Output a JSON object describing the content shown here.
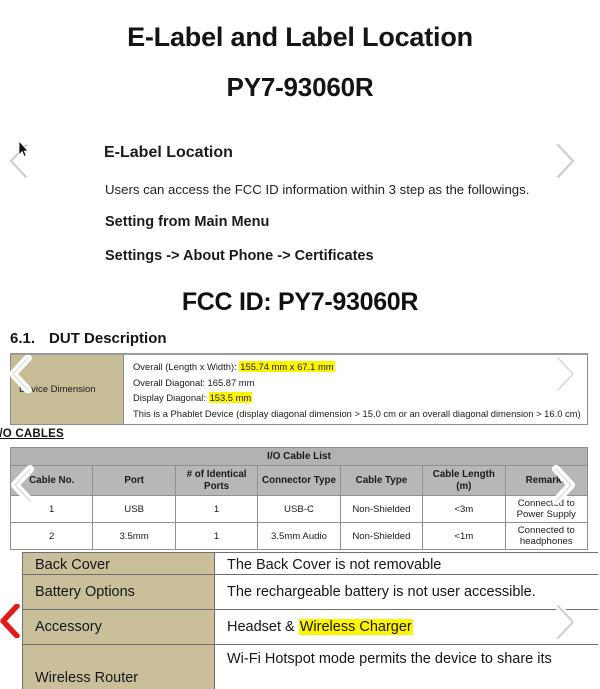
{
  "document": {
    "title": "E-Label and Label Location",
    "subtitle": "PY7-93060R"
  },
  "elabel": {
    "heading": "E-Label Location",
    "description": "Users can access the FCC ID information within 3 step as the followings.",
    "setting_heading": "Setting from Main Menu",
    "nav_path": "Settings -> About Phone -> Certificates",
    "fcc_id_display": "FCC ID: PY7-93060R"
  },
  "dut": {
    "section_number": "6.1.",
    "section_title": "DUT Description",
    "row_label": "Device Dimension",
    "lines": [
      {
        "prefix": "Overall (Length x Width): ",
        "highlight": "155.74 mm x 67.1 mm",
        "suffix": ""
      },
      {
        "prefix": "Overall Diagonal: 165.87 mm",
        "highlight": "",
        "suffix": ""
      },
      {
        "prefix": "Display Diagonal: ",
        "highlight": "153.5 mm",
        "suffix": ""
      },
      {
        "prefix": "This is a Phablet Device (display diagonal dimension > 15.0 cm or an overall diagonal dimension > 16.0 cm)",
        "highlight": "",
        "suffix": ""
      }
    ]
  },
  "io_cables": {
    "section_label": "I/O CABLES",
    "table_title": "I/O Cable List",
    "columns": [
      "Cable No.",
      "Port",
      "# of Identical Ports",
      "Connector Type",
      "Cable Type",
      "Cable Length (m)",
      "Remarks"
    ],
    "rows": [
      [
        "1",
        "USB",
        "1",
        "USB-C",
        "Non-Shielded",
        "<3m",
        "Connected to Power Supply"
      ],
      [
        "2",
        "3.5mm",
        "1",
        "3.5mm Audio",
        "Non-Shielded",
        "<1m",
        "Connected to headphones"
      ]
    ]
  },
  "spec_table": {
    "rows": [
      {
        "key": "Back Cover",
        "value_prefix": "The Back Cover is not removable",
        "value_highlight": "",
        "value_suffix": ""
      },
      {
        "key": "Battery Options",
        "value_prefix": "The rechargeable battery is not user accessible.",
        "value_highlight": "",
        "value_suffix": ""
      },
      {
        "key": "Accessory",
        "value_prefix": "Headset & ",
        "value_highlight": "Wireless Charger",
        "value_suffix": ""
      },
      {
        "key": "Wireless Router",
        "value_prefix": "Wi-Fi Hotspot mode permits the device to share its",
        "value_highlight": "",
        "value_suffix": ""
      }
    ]
  },
  "navigation": {
    "prev_label": "Previous",
    "next_label": "Next",
    "back_label": "Back"
  },
  "colors": {
    "highlight": "#fdf500",
    "beige": "#c9c09b",
    "table_header_gray": "#b5b5b5",
    "red_arrow": "#e01b18"
  }
}
